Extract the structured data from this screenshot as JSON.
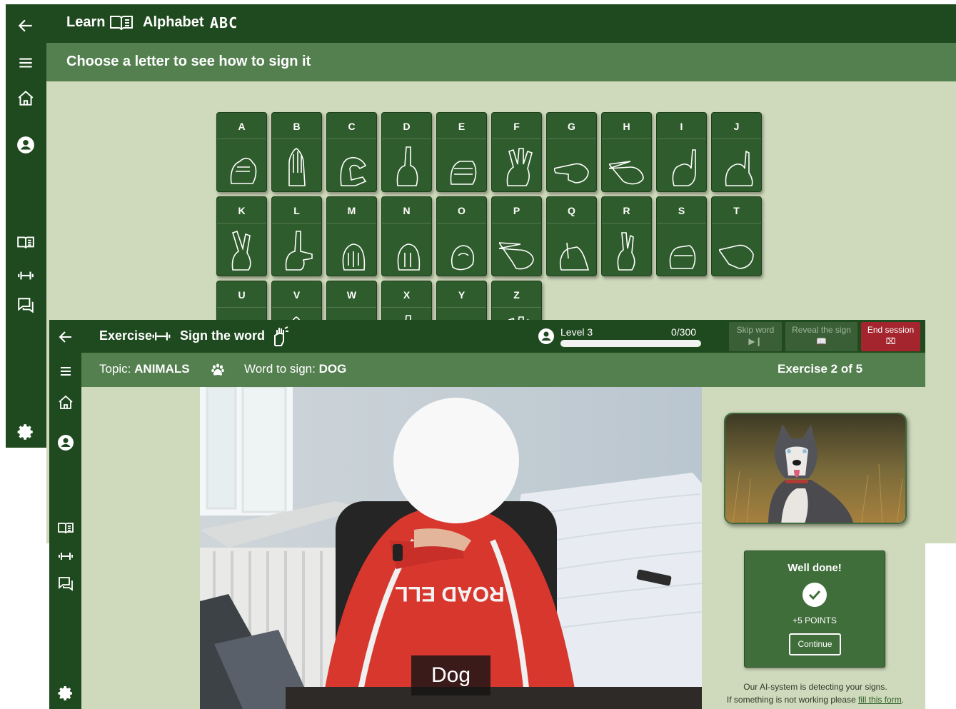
{
  "learn_window": {
    "header": {
      "title_learn": "Learn",
      "title_alphabet": "Alphabet",
      "title_abc": "ABC"
    },
    "subheader": "Choose a letter to see how to sign it",
    "letters": [
      "A",
      "B",
      "C",
      "D",
      "E",
      "F",
      "G",
      "H",
      "I",
      "J",
      "K",
      "L",
      "M",
      "N",
      "O",
      "P",
      "Q",
      "R",
      "S",
      "T",
      "U",
      "V",
      "W",
      "X",
      "Y",
      "Z"
    ],
    "rail_icons": [
      "back-arrow-icon",
      "menu-icon",
      "home-icon",
      "profile-icon",
      "book-icon",
      "dumbbell-icon",
      "chat-icon",
      "gear-icon"
    ]
  },
  "exercise_window": {
    "header": {
      "title_exercise": "Exercise",
      "title_sign": "Sign the word",
      "level_label": "Level 3",
      "progress_text": "0/300",
      "progress_fraction": 0.0,
      "skip_label": "Skip word",
      "reveal_label": "Reveal the sign",
      "end_label": "End session"
    },
    "subheader": {
      "topic_label": "Topic:",
      "topic_value": "ANIMALS",
      "word_label": "Word to sign:",
      "word_value": "DOG",
      "exercise_counter": "Exercise 2 of 5"
    },
    "video_caption": "Dog",
    "result": {
      "title": "Well done!",
      "points": "+5 POINTS",
      "continue_label": "Continue"
    },
    "ai_note": {
      "line1": "Our AI-system is detecting your signs.",
      "line2_prefix": "If something is not working please",
      "link_text": "fill this form",
      "line2_suffix": "."
    }
  },
  "colors": {
    "dark_green": "#1f4a1f",
    "mid_green": "#548050",
    "background": "#cfd9bb",
    "end_session_red": "#a4252d"
  }
}
